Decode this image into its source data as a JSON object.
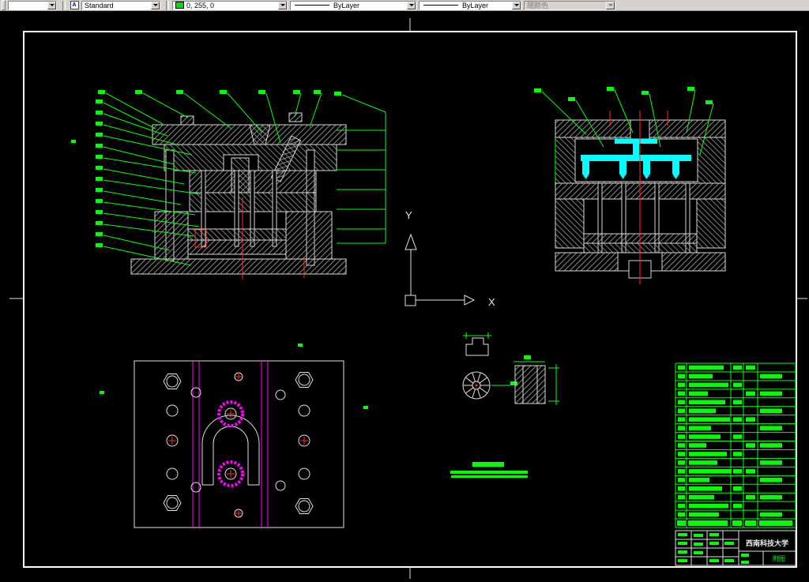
{
  "toolbar": {
    "layer_combo_value": "",
    "style_combo_value": "Standard",
    "color_combo_value": "0, 255, 0",
    "linetype_combo_value": "ByLayer",
    "lineweight_combo_value": "ByLayer",
    "plotstyle_combo_value": "随颜色"
  },
  "ucs": {
    "x_label": "X",
    "y_label": "Y"
  },
  "title_block": {
    "school_name": "西南科技大学",
    "drawing_label": "附图"
  },
  "colors": {
    "green": "#00ff00",
    "magenta": "#ff00ff",
    "cyan": "#00ffff",
    "red": "#ff2a2a",
    "line": "#e0e0e0",
    "swatch_green": "#00dd00",
    "toolbar_bg": "#d6d3ce"
  }
}
